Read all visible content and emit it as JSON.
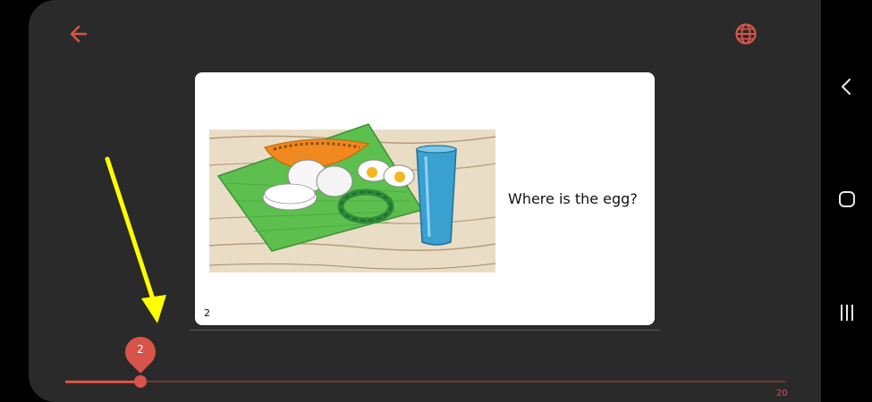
{
  "header": {
    "back_icon": "arrow-left-icon",
    "language_icon": "globe-icon",
    "accent_color": "#d8544a"
  },
  "page": {
    "text": "Where is the egg?",
    "page_number": "2",
    "illustration": "papaya, boiled eggs, green bean wreath and blue glass on a banana leaf"
  },
  "slider": {
    "current_label": "2",
    "current_value": 2,
    "max_label": "20",
    "max_value": 20
  },
  "annotation": {
    "arrow_color": "#ffff00"
  },
  "system_nav": {
    "back_icon": "nav-back-icon",
    "home_icon": "nav-home-icon",
    "recents_icon": "nav-recents-icon"
  }
}
